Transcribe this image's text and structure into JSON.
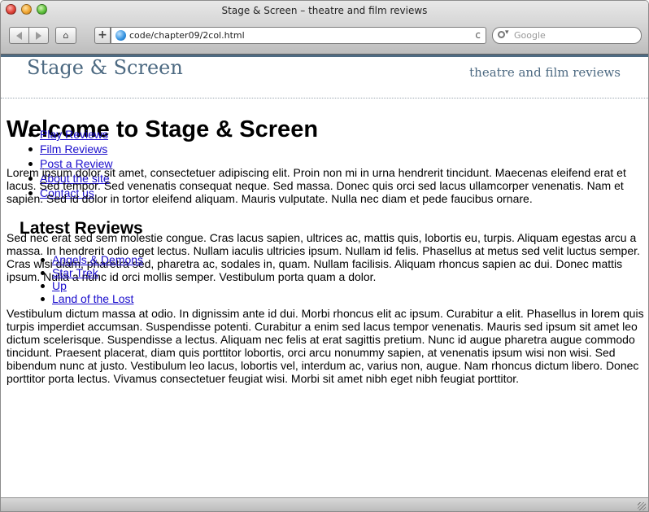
{
  "window": {
    "title": "Stage & Screen – theatre and film reviews"
  },
  "toolbar": {
    "home_label": "⌂",
    "add_label": "+",
    "url": "code/chapter09/2col.html",
    "reload_label": "c",
    "search_placeholder": "Google"
  },
  "site": {
    "title": "Stage & Screen",
    "tagline": "theatre and film reviews",
    "accent_color": "#4d6a82"
  },
  "nav": {
    "items": [
      "Play Reviews",
      "Film Reviews",
      "Post a Review",
      "About the site",
      "Contact us"
    ]
  },
  "main": {
    "heading": "Welcome to Stage & Screen",
    "paragraph1": "Lorem ipsum dolor sit amet, consectetuer adipiscing elit. Proin non mi in urna hendrerit tincidunt. Maecenas eleifend erat et lacus. Sed tempor. Sed venenatis consequat neque. Sed massa. Donec quis orci sed lacus ullamcorper venenatis. Nam et sapien. Sed id dolor in tortor eleifend aliquam. Mauris vulputate. Nulla nec diam et pede faucibus ornare.",
    "paragraph2": "Sed nec erat sed sem molestie congue. Cras lacus sapien, ultrices ac, mattis quis, lobortis eu, turpis. Aliquam egestas arcu a massa. In hendrerit odio eget lectus. Nullam iaculis ultricies ipsum. Nullam id felis. Phasellus at metus sed velit luctus semper. Cras wisi diam, pharetra sed, pharetra ac, sodales in, quam. Nullam facilisis. Aliquam rhoncus sapien ac dui. Donec mattis ipsum. Nulla a nunc id orci mollis semper. Vestibulum porta quam a dolor.",
    "paragraph3": "Vestibulum dictum massa at odio. In dignissim ante id dui. Morbi rhoncus elit ac ipsum. Curabitur a elit. Phasellus in lorem quis turpis imperdiet accumsan. Suspendisse potenti. Curabitur a enim sed lacus tempor venenatis. Mauris sed ipsum sit amet leo dictum scelerisque. Suspendisse a lectus. Aliquam nec felis at erat sagittis pretium. Nunc id augue pharetra augue commodo tincidunt. Praesent placerat, diam quis porttitor lobortis, orci arcu nonummy sapien, at venenatis ipsum wisi non wisi. Sed bibendum nunc at justo. Vestibulum leo lacus, lobortis vel, interdum ac, varius non, augue. Nam rhoncus dictum libero. Donec porttitor porta lectus. Vivamus consectetuer feugiat wisi. Morbi sit amet nibh eget nibh feugiat porttitor."
  },
  "latest": {
    "heading": "Latest Reviews",
    "items": [
      "Angels & Demons",
      "Star Trek",
      "Up",
      "Land of the Lost"
    ]
  }
}
